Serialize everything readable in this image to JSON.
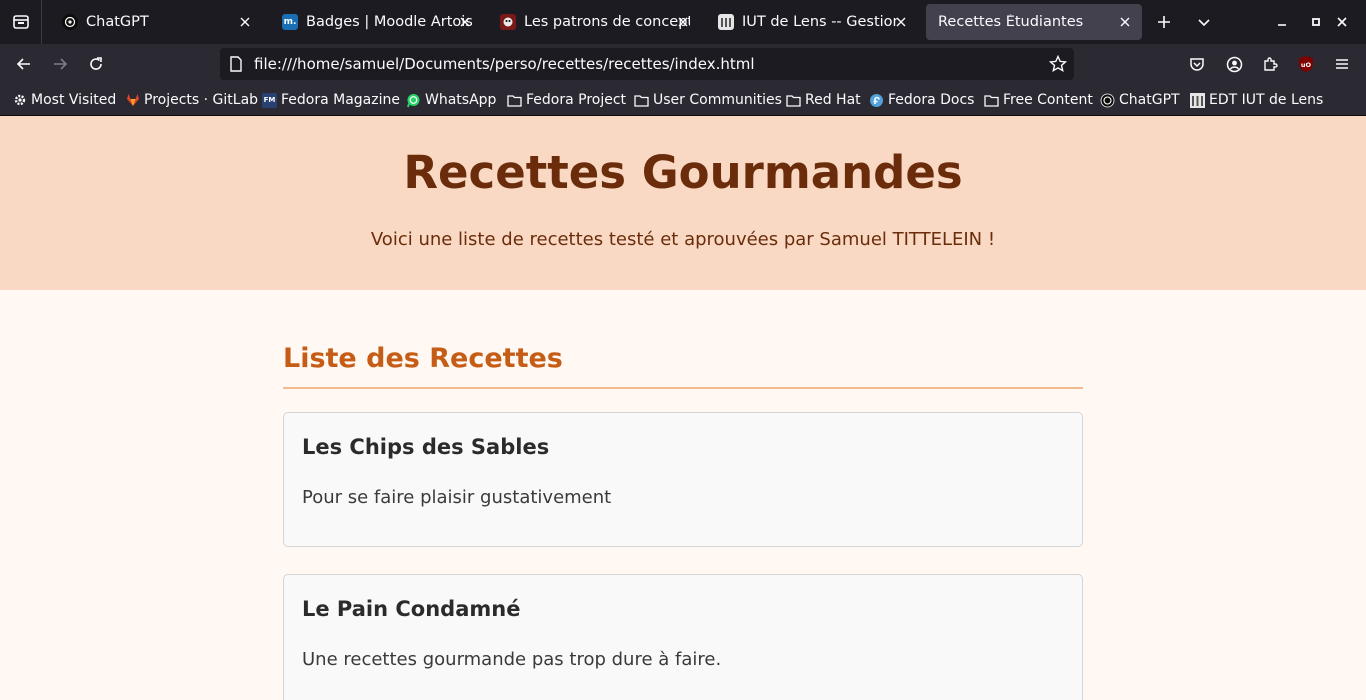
{
  "browser": {
    "tabs": [
      {
        "title": "ChatGPT",
        "icon": "chatgpt-icon",
        "active": false
      },
      {
        "title": "Badges | Moodle Artois",
        "icon": "moodle-icon",
        "active": false
      },
      {
        "title": "Les patrons de conceptio",
        "icon": "patrons-icon",
        "active": false
      },
      {
        "title": "IUT de Lens -- Gestion d",
        "icon": "iut-icon",
        "active": false
      },
      {
        "title": "Recettes Étudiantes",
        "icon": "",
        "active": true
      }
    ],
    "url": "file:///home/samuel/Documents/perso/recettes/recettes/index.html",
    "bookmarks": [
      {
        "label": "Most Visited",
        "icon": "gear-icon"
      },
      {
        "label": "Projects · GitLab",
        "icon": "gitlab-icon"
      },
      {
        "label": "Fedora Magazine",
        "icon": "fedora-magazine-icon"
      },
      {
        "label": "WhatsApp",
        "icon": "whatsapp-icon"
      },
      {
        "label": "Fedora Project",
        "icon": "folder-icon"
      },
      {
        "label": "User Communities",
        "icon": "folder-icon"
      },
      {
        "label": "Red Hat",
        "icon": "folder-icon"
      },
      {
        "label": "Fedora Docs",
        "icon": "fedora-icon"
      },
      {
        "label": "Free Content",
        "icon": "folder-icon"
      },
      {
        "label": "ChatGPT",
        "icon": "chatgpt-icon"
      },
      {
        "label": "EDT IUT de Lens",
        "icon": "iut-icon"
      }
    ]
  },
  "page": {
    "title": "Recettes Gourmandes",
    "subtitle": "Voici une liste de recettes testé et aprouvées par Samuel TITTELEIN !",
    "section_title": "Liste des Recettes",
    "recipes": [
      {
        "title": "Les Chips des Sables",
        "description": "Pour se faire plaisir gustativement"
      },
      {
        "title": "Le Pain Condamné",
        "description": "Une recettes gourmande pas trop dure à faire."
      }
    ]
  },
  "colors": {
    "header_bg": "#f9d9c3",
    "title": "#6b2c0b",
    "section_title": "#c55d16",
    "page_bg": "#fff8f3"
  }
}
